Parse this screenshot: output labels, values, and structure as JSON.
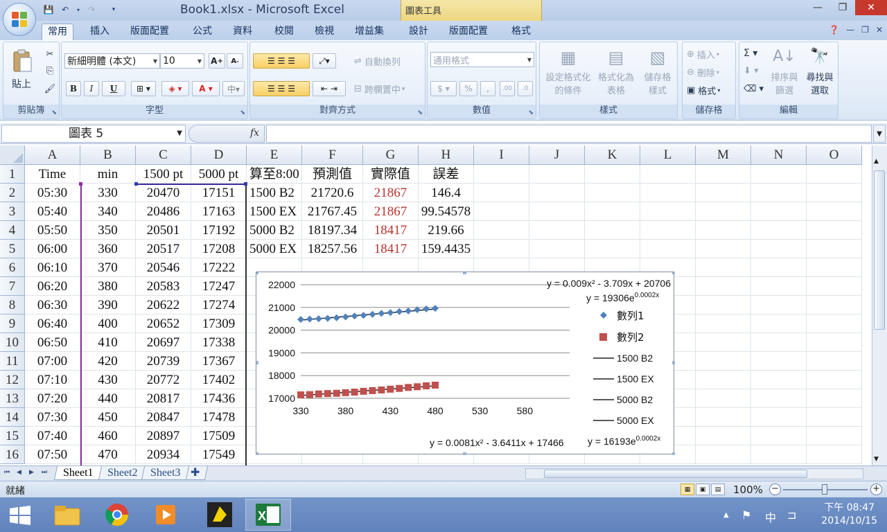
{
  "window": {
    "title": "Book1.xlsx - Microsoft Excel",
    "context_tool_title": "圖表工具"
  },
  "ribbon_tabs": [
    "常用",
    "插入",
    "版面配置",
    "公式",
    "資料",
    "校閱",
    "檢視",
    "增益集",
    "設計",
    "版面配置",
    "格式"
  ],
  "ribbon": {
    "clipboard": {
      "label": "剪貼簿",
      "paste": "貼上"
    },
    "font": {
      "label": "字型",
      "font_name": "新細明體 (本文)",
      "font_size": "10",
      "bold": "B",
      "italic": "I",
      "underline": "U"
    },
    "alignment": {
      "label": "對齊方式",
      "wrap_text": "自動換列",
      "merge_center": "跨欄置中"
    },
    "number": {
      "label": "數值",
      "format": "通用格式"
    },
    "styles": {
      "label": "樣式",
      "conditional": [
        "設定格式化",
        "的條件"
      ],
      "format_as_table": [
        "格式化為",
        "表格"
      ],
      "cell_styles": [
        "儲存格",
        "樣式"
      ]
    },
    "cells": {
      "label": "儲存格",
      "insert": "插入",
      "delete": "刪除",
      "format": "格式"
    },
    "editing": {
      "label": "編輯",
      "sort_filter": [
        "排序與",
        "篩選"
      ],
      "find_select": [
        "尋找與",
        "選取"
      ]
    }
  },
  "formula_bar": {
    "name_box": "圖表 5",
    "fx": "fx",
    "formula": ""
  },
  "columns": [
    "A",
    "B",
    "C",
    "D",
    "E",
    "F",
    "G",
    "H",
    "I",
    "J",
    "K",
    "L",
    "M",
    "N",
    "O"
  ],
  "rows": [
    {
      "n": "1",
      "A": "Time",
      "B": "min",
      "C": "1500 pt",
      "D": "5000 pt",
      "E": "算至8:00",
      "F": "預測值",
      "G": "實際值",
      "H": "誤差"
    },
    {
      "n": "2",
      "A": "05:30",
      "B": "330",
      "C": "20470",
      "D": "17151",
      "E": "1500 B2",
      "F": "21720.6",
      "G": "21867",
      "H": "146.4"
    },
    {
      "n": "3",
      "A": "05:40",
      "B": "340",
      "C": "20486",
      "D": "17163",
      "E": "1500 EX",
      "F": "21767.45",
      "G": "21867",
      "H": "99.54578"
    },
    {
      "n": "4",
      "A": "05:50",
      "B": "350",
      "C": "20501",
      "D": "17192",
      "E": "5000 B2",
      "F": "18197.34",
      "G": "18417",
      "H": "219.66"
    },
    {
      "n": "5",
      "A": "06:00",
      "B": "360",
      "C": "20517",
      "D": "17208",
      "E": "5000 EX",
      "F": "18257.56",
      "G": "18417",
      "H": "159.4435"
    },
    {
      "n": "6",
      "A": "06:10",
      "B": "370",
      "C": "20546",
      "D": "17222"
    },
    {
      "n": "7",
      "A": "06:20",
      "B": "380",
      "C": "20583",
      "D": "17247"
    },
    {
      "n": "8",
      "A": "06:30",
      "B": "390",
      "C": "20622",
      "D": "17274"
    },
    {
      "n": "9",
      "A": "06:40",
      "B": "400",
      "C": "20652",
      "D": "17309"
    },
    {
      "n": "10",
      "A": "06:50",
      "B": "410",
      "C": "20697",
      "D": "17338"
    },
    {
      "n": "11",
      "A": "07:00",
      "B": "420",
      "C": "20739",
      "D": "17367"
    },
    {
      "n": "12",
      "A": "07:10",
      "B": "430",
      "C": "20772",
      "D": "17402"
    },
    {
      "n": "13",
      "A": "07:20",
      "B": "440",
      "C": "20817",
      "D": "17436"
    },
    {
      "n": "14",
      "A": "07:30",
      "B": "450",
      "C": "20847",
      "D": "17478"
    },
    {
      "n": "15",
      "A": "07:40",
      "B": "460",
      "C": "20897",
      "D": "17509"
    },
    {
      "n": "16",
      "A": "07:50",
      "B": "470",
      "C": "20934",
      "D": "17549"
    }
  ],
  "chart_data": {
    "type": "scatter",
    "title": "",
    "xlim": [
      330,
      630
    ],
    "ylim": [
      17000,
      22000
    ],
    "xticks": [
      "330",
      "380",
      "430",
      "480",
      "530",
      "580"
    ],
    "yticks": [
      "17000",
      "18000",
      "19000",
      "20000",
      "21000",
      "22000"
    ],
    "grid": true,
    "legend_position": "right",
    "series": [
      {
        "name": "數列1",
        "marker": "diamond",
        "color": "#4f81bd",
        "x": [
          330,
          340,
          350,
          360,
          370,
          380,
          390,
          400,
          410,
          420,
          430,
          440,
          450,
          460,
          470,
          480
        ],
        "y": [
          20470,
          20486,
          20501,
          20517,
          20546,
          20583,
          20622,
          20652,
          20697,
          20739,
          20772,
          20817,
          20847,
          20897,
          20934,
          20960
        ]
      },
      {
        "name": "數列2",
        "marker": "square",
        "color": "#c0504d",
        "x": [
          330,
          340,
          350,
          360,
          370,
          380,
          390,
          400,
          410,
          420,
          430,
          440,
          450,
          460,
          470,
          480
        ],
        "y": [
          17151,
          17163,
          17192,
          17208,
          17222,
          17247,
          17274,
          17309,
          17338,
          17367,
          17402,
          17436,
          17478,
          17509,
          17549,
          17580
        ]
      }
    ],
    "trendline_legend": [
      "1500 B2",
      "1500 EX",
      "5000 B2",
      "5000 EX"
    ],
    "equations": {
      "top_poly": "y = 0.009x² - 3.709x + 20706",
      "top_exp": "y = 19306e^0.0002x",
      "bottom_poly": "y = 0.0081x² - 3.6411x + 17466",
      "bottom_exp": "y = 16193e^0.0002x"
    }
  },
  "sheets": [
    "Sheet1",
    "Sheet2",
    "Sheet3"
  ],
  "status": {
    "text": "就緒",
    "zoom": "100%"
  },
  "taskbar": {
    "time": "下午 08:47",
    "date": "2014/10/15",
    "ime": "中"
  },
  "colors": {
    "accent": "#2a4e8a",
    "series1": "#4f81bd",
    "series2": "#c0504d",
    "red_text": "#b8332e"
  }
}
